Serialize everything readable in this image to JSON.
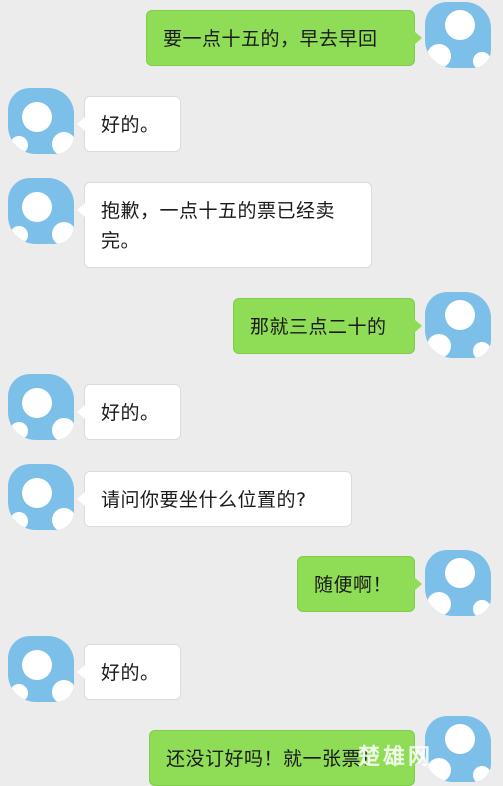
{
  "messages": [
    {
      "side": "out",
      "text": "要一点十五的，早去早回"
    },
    {
      "side": "in",
      "text": "好的。"
    },
    {
      "side": "in",
      "text": "抱歉，一点十五的票已经卖完。"
    },
    {
      "side": "out",
      "text": "那就三点二十的"
    },
    {
      "side": "in",
      "text": "好的。"
    },
    {
      "side": "in",
      "text": "请问你要坐什么位置的?"
    },
    {
      "side": "out",
      "text": "随便啊！"
    },
    {
      "side": "in",
      "text": "好的。"
    },
    {
      "side": "out",
      "text": "还没订好吗！就一张票！"
    }
  ],
  "watermark": "楚雄网",
  "colors": {
    "background": "#ececec",
    "incoming_bubble": "#ffffff",
    "outgoing_bubble": "#8fdc57",
    "avatar": "#7cbfe9"
  }
}
